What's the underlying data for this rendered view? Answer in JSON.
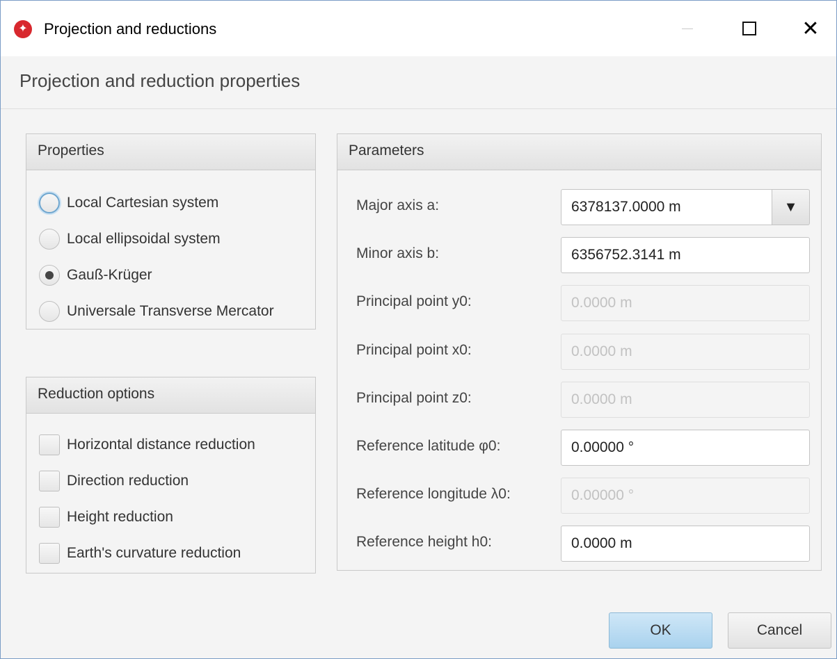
{
  "window": {
    "title": "Projection and reductions",
    "close_glyph": "✕"
  },
  "dialog": {
    "heading": "Projection and reduction properties"
  },
  "properties": {
    "header": "Properties",
    "options": [
      {
        "label": "Local Cartesian system",
        "selected": false,
        "focused": true
      },
      {
        "label": "Local ellipsoidal system",
        "selected": false,
        "focused": false
      },
      {
        "label": "Gauß-Krüger",
        "selected": true,
        "focused": false
      },
      {
        "label": "Universale Transverse Mercator",
        "selected": false,
        "focused": false
      }
    ]
  },
  "reduction": {
    "header": "Reduction options",
    "options": [
      {
        "label": "Horizontal distance reduction",
        "checked": false
      },
      {
        "label": "Direction reduction",
        "checked": false
      },
      {
        "label": "Height reduction",
        "checked": false
      },
      {
        "label": "Earth's curvature reduction",
        "checked": false
      }
    ]
  },
  "parameters": {
    "header": "Parameters",
    "dropdown_glyph": "▼",
    "rows": [
      {
        "label": "Major axis a:",
        "value": "6378137.0000 m",
        "enabled": true
      },
      {
        "label": "Minor axis b:",
        "value": "6356752.3141 m",
        "enabled": true
      },
      {
        "label": "Principal point y0:",
        "value": "0.0000 m",
        "enabled": false
      },
      {
        "label": "Principal point x0:",
        "value": "0.0000 m",
        "enabled": false
      },
      {
        "label": "Principal point z0:",
        "value": "0.0000 m",
        "enabled": false
      },
      {
        "label": "Reference latitude φ0:",
        "value": "0.00000 °",
        "enabled": true
      },
      {
        "label": "Reference longitude λ0:",
        "value": "0.00000 °",
        "enabled": false
      },
      {
        "label": "Reference height h0:",
        "value": "0.0000 m",
        "enabled": true
      }
    ]
  },
  "buttons": {
    "ok": "OK",
    "cancel": "Cancel"
  },
  "colors": {
    "app_icon": "#d8282e",
    "ok_button": "#a9d2ee",
    "focus_ring": "#6ea6cf"
  }
}
